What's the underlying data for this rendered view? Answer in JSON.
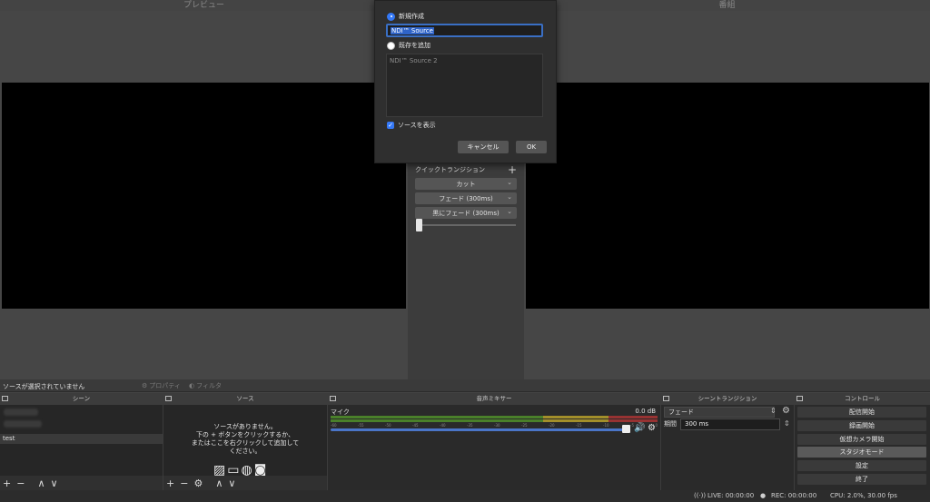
{
  "preview": {
    "title": "プレビュー"
  },
  "program": {
    "title": "番組"
  },
  "quick_transitions": {
    "label": "クイックトランジション",
    "add_icon": "plus-icon",
    "buttons": [
      {
        "label": "カット"
      },
      {
        "label": "フェード (300ms)"
      },
      {
        "label": "黒にフェード (300ms)"
      }
    ]
  },
  "dialog": {
    "create_new_label": "新規作成",
    "name_value": "NDI™ Source",
    "add_existing_label": "既存を追加",
    "existing_sources": [
      "NDI™ Source 2"
    ],
    "make_visible_label": "ソースを表示",
    "cancel_label": "キャンセル",
    "ok_label": "OK"
  },
  "source_toolbar": {
    "no_source_text": "ソースが選択されていません",
    "properties_label": "プロパティ",
    "filters_label": "フィルタ"
  },
  "scenes": {
    "title": "シーン",
    "items": [
      "test"
    ]
  },
  "sources": {
    "title": "ソース",
    "empty_line1": "ソースがありません。",
    "empty_line2": "下の + ボタンをクリックするか、",
    "empty_line3": "またはここを右クリックして追加して",
    "empty_line4": "ください。"
  },
  "mixer": {
    "title": "音声ミキサー",
    "channel": "マイク",
    "level": "0.0 dB",
    "ticks": [
      "-60",
      "-55",
      "-50",
      "-45",
      "-40",
      "-35",
      "-30",
      "-25",
      "-20",
      "-15",
      "-10",
      "-5",
      "0"
    ]
  },
  "scene_transitions": {
    "title": "シーントランジション",
    "selected": "フェード",
    "duration_label": "期間",
    "duration_value": "300 ms"
  },
  "controls": {
    "title": "コントロール",
    "buttons": [
      "配信開始",
      "録画開始",
      "仮想カメラ開始",
      "スタジオモード",
      "設定",
      "終了"
    ]
  },
  "status": {
    "live": "LIVE: 00:00:00",
    "rec": "REC: 00:00:00",
    "cpu": "CPU: 2.0%, 30.00 fps"
  }
}
